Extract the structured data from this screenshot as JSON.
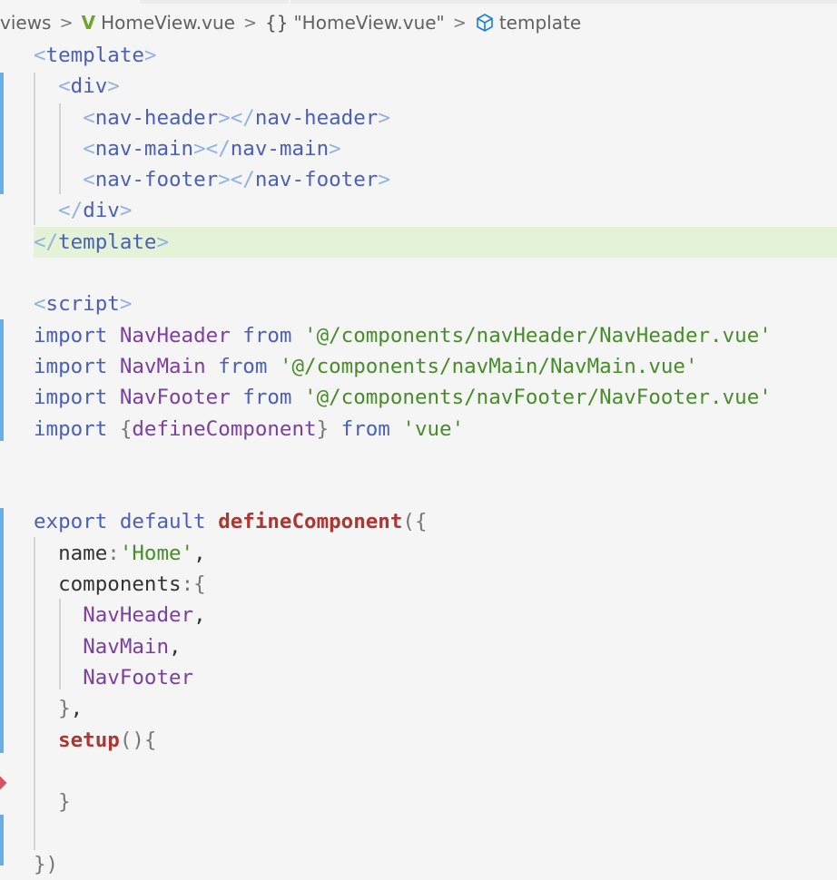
{
  "breadcrumb": {
    "items": [
      {
        "label": "views",
        "icon": "folder"
      },
      {
        "label": "HomeView.vue",
        "icon": "vue-logo-icon"
      },
      {
        "label": "\"HomeView.vue\"",
        "icon": "braces-icon"
      },
      {
        "label": "template",
        "icon": "cube-icon"
      }
    ]
  },
  "editor": {
    "lines": [
      [
        [
          "tb",
          "<"
        ],
        [
          "tn",
          "template"
        ],
        [
          "tb",
          ">"
        ]
      ],
      [
        [
          "tx",
          "  "
        ],
        [
          "tb",
          "<"
        ],
        [
          "tn",
          "div"
        ],
        [
          "tb",
          ">"
        ]
      ],
      [
        [
          "tx",
          "    "
        ],
        [
          "tb",
          "<"
        ],
        [
          "tn",
          "nav-header"
        ],
        [
          "tb",
          "></"
        ],
        [
          "tn",
          "nav-header"
        ],
        [
          "tb",
          ">"
        ]
      ],
      [
        [
          "tx",
          "    "
        ],
        [
          "tb",
          "<"
        ],
        [
          "tn",
          "nav-main"
        ],
        [
          "tb",
          "></"
        ],
        [
          "tn",
          "nav-main"
        ],
        [
          "tb",
          ">"
        ]
      ],
      [
        [
          "tx",
          "    "
        ],
        [
          "tb",
          "<"
        ],
        [
          "tn",
          "nav-footer"
        ],
        [
          "tb",
          "></"
        ],
        [
          "tn",
          "nav-footer"
        ],
        [
          "tb",
          ">"
        ]
      ],
      [
        [
          "tx",
          "  "
        ],
        [
          "tb",
          "</"
        ],
        [
          "tn",
          "div"
        ],
        [
          "tb",
          ">"
        ]
      ],
      [
        [
          "tb",
          "</"
        ],
        [
          "tn",
          "template"
        ],
        [
          "tb",
          ">"
        ]
      ],
      [],
      [
        [
          "tb",
          "<"
        ],
        [
          "tn",
          "script"
        ],
        [
          "tb",
          ">"
        ]
      ],
      [
        [
          "kw",
          "import "
        ],
        [
          "id",
          "NavHeader "
        ],
        [
          "kw",
          "from "
        ],
        [
          "str",
          "'@/components/navHeader/NavHeader.vue'"
        ]
      ],
      [
        [
          "kw",
          "import "
        ],
        [
          "id",
          "NavMain "
        ],
        [
          "kw",
          "from "
        ],
        [
          "str",
          "'@/components/navMain/NavMain.vue'"
        ]
      ],
      [
        [
          "kw",
          "import "
        ],
        [
          "id",
          "NavFooter "
        ],
        [
          "kw",
          "from "
        ],
        [
          "str",
          "'@/components/navFooter/NavFooter.vue'"
        ]
      ],
      [
        [
          "kw",
          "import "
        ],
        [
          "pn",
          "{"
        ],
        [
          "id",
          "defineComponent"
        ],
        [
          "pn",
          "} "
        ],
        [
          "kw",
          "from "
        ],
        [
          "str",
          "'vue'"
        ]
      ],
      [],
      [],
      [
        [
          "kw",
          "export default "
        ],
        [
          "fn",
          "defineComponent"
        ],
        [
          "pn",
          "({"
        ]
      ],
      [
        [
          "tx",
          "  name"
        ],
        [
          "pn",
          ":"
        ],
        [
          "str",
          "'Home'"
        ],
        [
          "tx",
          ","
        ]
      ],
      [
        [
          "tx",
          "  components"
        ],
        [
          "pn",
          ":{"
        ]
      ],
      [
        [
          "tx",
          "    "
        ],
        [
          "id",
          "NavHeader"
        ],
        [
          "tx",
          ","
        ]
      ],
      [
        [
          "tx",
          "    "
        ],
        [
          "id",
          "NavMain"
        ],
        [
          "tx",
          ","
        ]
      ],
      [
        [
          "tx",
          "    "
        ],
        [
          "id",
          "NavFooter"
        ]
      ],
      [
        [
          "tx",
          "  "
        ],
        [
          "pn",
          "}"
        ],
        [
          "tx",
          ","
        ]
      ],
      [
        [
          "tx",
          "  "
        ],
        [
          "fn",
          "setup"
        ],
        [
          "pn",
          "(){"
        ]
      ],
      [],
      [
        [
          "tx",
          "  "
        ],
        [
          "pn",
          "}"
        ]
      ],
      [],
      [
        [
          "pn",
          "})"
        ]
      ]
    ],
    "highlighted_line": 7
  }
}
